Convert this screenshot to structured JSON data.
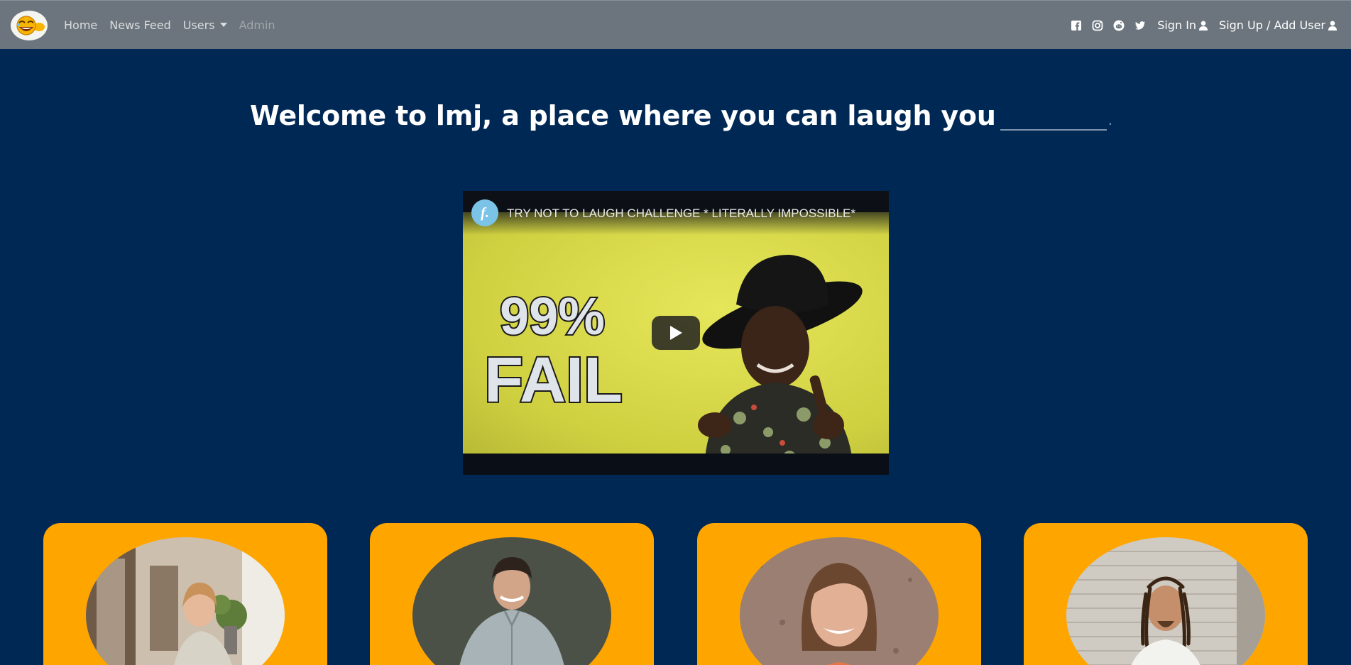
{
  "nav": {
    "brand_icon": "laughing-emoji-logo-icon",
    "home": "Home",
    "news_feed": "News Feed",
    "users": "Users",
    "admin": "Admin",
    "social_icons": [
      "facebook-icon",
      "instagram-icon",
      "reddit-icon",
      "twitter-icon"
    ],
    "sign_in": "Sign In",
    "sign_up": "Sign Up / Add User",
    "text_color": "#ffffff",
    "background": "#6c757d"
  },
  "hero": {
    "headline": "Welcome to lmj, a place where you can laugh you",
    "blank_end": "."
  },
  "video": {
    "channel_initial": "f.",
    "title": "TRY NOT TO LAUGH CHALLENGE * LITERALLY IMPOSSIBLE*",
    "thumb_big_text_1": "99%",
    "thumb_big_text_2": "FAIL",
    "play_icon": "play-icon"
  },
  "cards": {
    "background": "#ffa500",
    "items": [
      {
        "photo": "woman-laughing-cafe-photo"
      },
      {
        "photo": "man-smiling-photo"
      },
      {
        "photo": "woman-smiling-photo"
      },
      {
        "photo": "man-dreadlocks-photo"
      }
    ]
  },
  "page": {
    "background": "#002855"
  }
}
